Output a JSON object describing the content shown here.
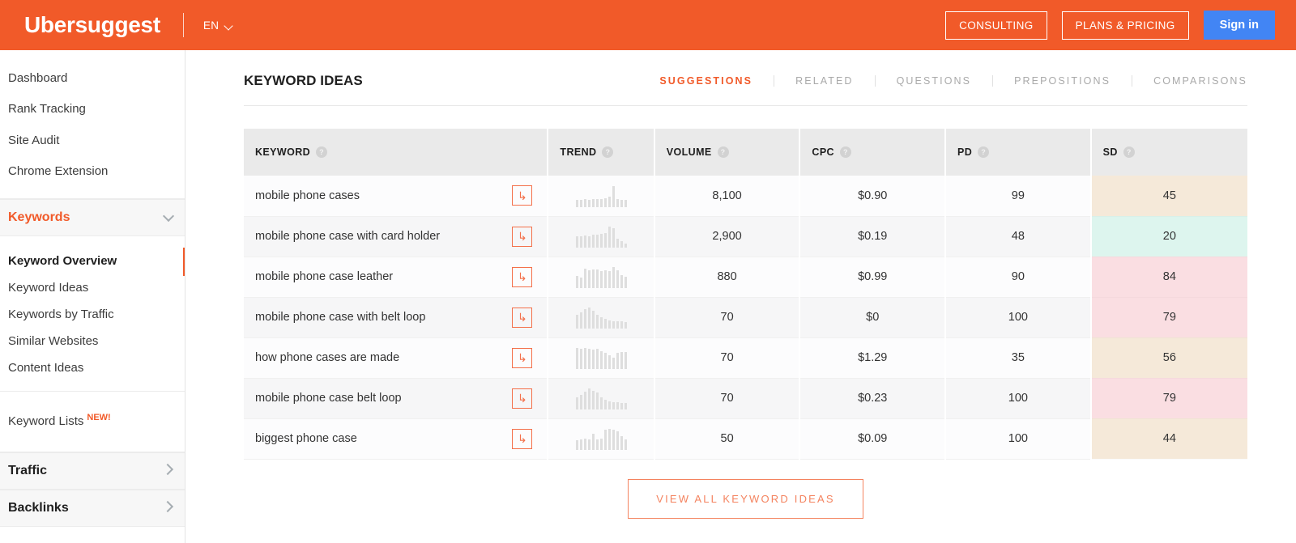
{
  "header": {
    "brand": "Ubersuggest",
    "language": "EN",
    "consulting_label": "CONSULTING",
    "plans_label": "PLANS & PRICING",
    "signin_label": "Sign in",
    "accent": "#f15a29",
    "signin_color": "#4285f4"
  },
  "sidebar": {
    "top_items": [
      {
        "label": "Dashboard"
      },
      {
        "label": "Rank Tracking"
      },
      {
        "label": "Site Audit"
      },
      {
        "label": "Chrome Extension"
      }
    ],
    "keywords_section": {
      "label": "Keywords",
      "expanded": true,
      "icon": "chevron-down-icon"
    },
    "keyword_items": [
      {
        "label": "Keyword Overview",
        "active": true
      },
      {
        "label": "Keyword Ideas",
        "active": false
      },
      {
        "label": "Keywords by Traffic",
        "active": false
      },
      {
        "label": "Similar Websites",
        "active": false
      },
      {
        "label": "Content Ideas",
        "active": false
      }
    ],
    "lists": {
      "label": "Keyword Lists",
      "badge": "NEW!"
    },
    "traffic_section": {
      "label": "Traffic",
      "icon": "chevron-right-icon"
    },
    "backlinks_section": {
      "label": "Backlinks",
      "icon": "chevron-right-icon"
    }
  },
  "main": {
    "panel_title": "KEYWORD IDEAS",
    "tabs": [
      {
        "label": "SUGGESTIONS",
        "active": true
      },
      {
        "label": "RELATED",
        "active": false
      },
      {
        "label": "QUESTIONS",
        "active": false
      },
      {
        "label": "PREPOSITIONS",
        "active": false
      },
      {
        "label": "COMPARISONS",
        "active": false
      }
    ],
    "columns": [
      {
        "label": "KEYWORD",
        "help": "?"
      },
      {
        "label": "TREND",
        "help": "?"
      },
      {
        "label": "VOLUME",
        "help": "?"
      },
      {
        "label": "CPC",
        "help": "?"
      },
      {
        "label": "PD",
        "help": "?"
      },
      {
        "label": "SD",
        "help": "?"
      }
    ],
    "rows": [
      {
        "keyword": "mobile phone cases",
        "action_icon": "return-arrow-icon",
        "trend": [
          8,
          8,
          9,
          8,
          9,
          9,
          9,
          10,
          12,
          24,
          9,
          8,
          8
        ],
        "volume": "8,100",
        "cpc": "$0.90",
        "pd": "99",
        "sd": "45",
        "sd_bg": "#f5e9d9"
      },
      {
        "keyword": "mobile phone case with card holder",
        "action_icon": "return-arrow-icon",
        "trend": [
          13,
          13,
          14,
          13,
          15,
          15,
          16,
          17,
          24,
          22,
          10,
          7,
          5
        ],
        "volume": "2,900",
        "cpc": "$0.19",
        "pd": "48",
        "sd": "20",
        "sd_bg": "#ddf5ee"
      },
      {
        "keyword": "mobile phone case leather",
        "action_icon": "return-arrow-icon",
        "trend": [
          14,
          12,
          22,
          20,
          21,
          21,
          19,
          20,
          19,
          24,
          20,
          15,
          13
        ],
        "volume": "880",
        "cpc": "$0.99",
        "pd": "90",
        "sd": "84",
        "sd_bg": "#fadee2"
      },
      {
        "keyword": "mobile phone case with belt loop",
        "action_icon": "return-arrow-icon",
        "trend": [
          16,
          18,
          22,
          24,
          20,
          16,
          13,
          11,
          9,
          8,
          8,
          8,
          7
        ],
        "volume": "70",
        "cpc": "$0",
        "pd": "100",
        "sd": "79",
        "sd_bg": "#fadee2"
      },
      {
        "keyword": "how phone cases are made",
        "action_icon": "return-arrow-icon",
        "trend": [
          22,
          21,
          22,
          21,
          20,
          21,
          19,
          17,
          14,
          12,
          17,
          18,
          18
        ],
        "volume": "70",
        "cpc": "$1.29",
        "pd": "35",
        "sd": "56",
        "sd_bg": "#f5e9d9"
      },
      {
        "keyword": "mobile phone case belt loop",
        "action_icon": "return-arrow-icon",
        "trend": [
          14,
          17,
          20,
          24,
          21,
          19,
          14,
          11,
          9,
          8,
          8,
          7,
          7
        ],
        "volume": "70",
        "cpc": "$0.23",
        "pd": "100",
        "sd": "79",
        "sd_bg": "#fadee2"
      },
      {
        "keyword": "biggest phone case",
        "action_icon": "return-arrow-icon",
        "trend": [
          8,
          9,
          10,
          9,
          14,
          9,
          10,
          17,
          18,
          17,
          16,
          12,
          9
        ],
        "volume": "50",
        "cpc": "$0.09",
        "pd": "100",
        "sd": "44",
        "sd_bg": "#f5e9d9"
      }
    ],
    "view_all_label": "VIEW ALL KEYWORD IDEAS"
  }
}
